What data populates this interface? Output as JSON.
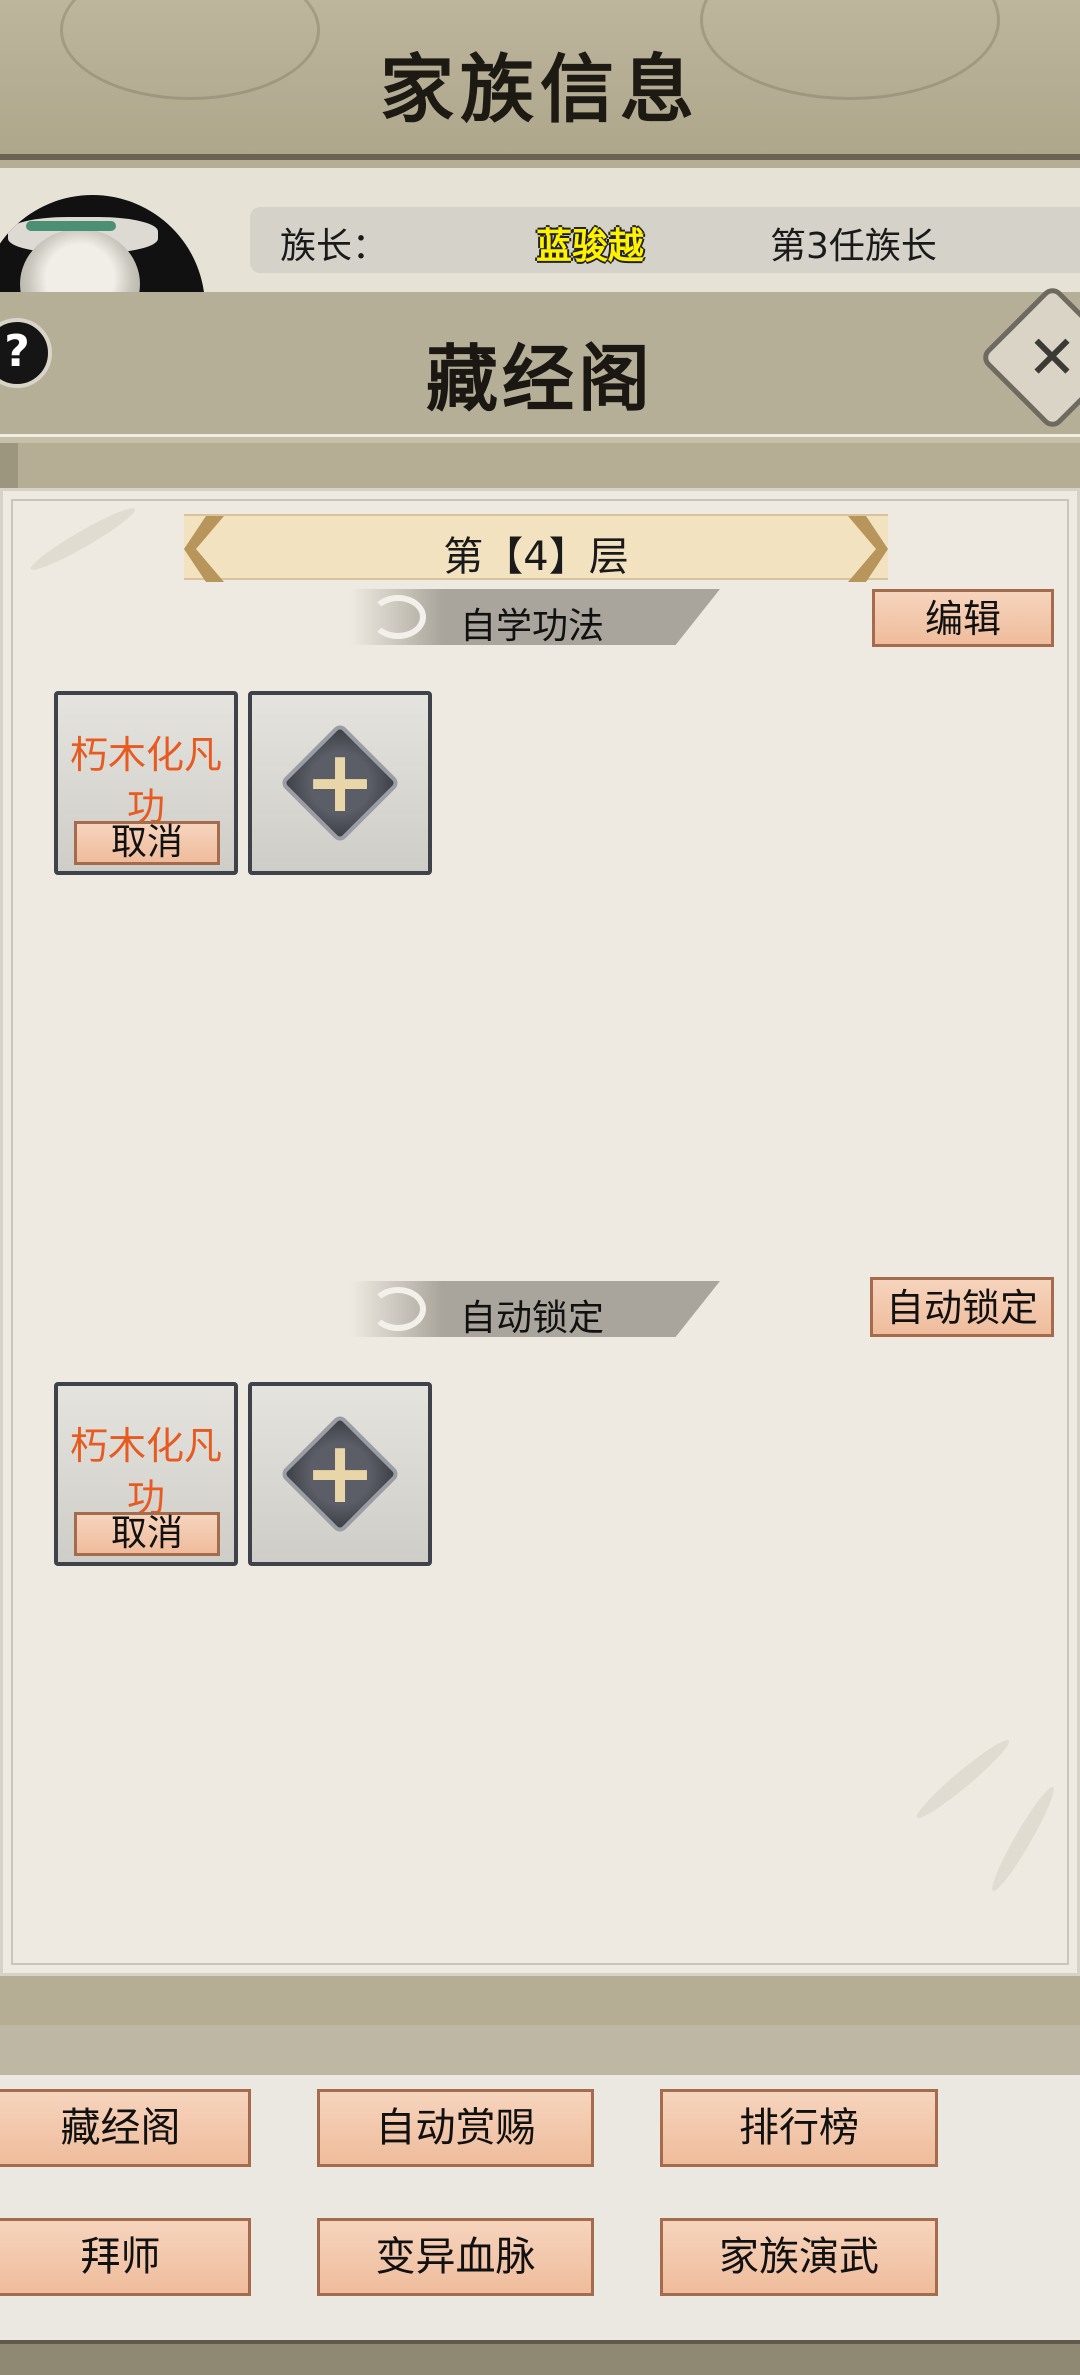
{
  "header": {
    "title": "家族信息"
  },
  "chief": {
    "label": "族长：",
    "name": "蓝骏越",
    "rank": "第3任族长"
  },
  "modal": {
    "title": "藏经阁",
    "help_label": "?",
    "close_label": "✕"
  },
  "floor": {
    "label": "第【4】层"
  },
  "sections": [
    {
      "title": "自学功法",
      "action_label": "编辑",
      "items": [
        {
          "name": "朽木化凡功",
          "cancel_label": "取消"
        }
      ],
      "add_label": "+"
    },
    {
      "title": "自动锁定",
      "action_label": "自动锁定",
      "items": [
        {
          "name": "朽木化凡功",
          "cancel_label": "取消"
        }
      ],
      "add_label": "+"
    }
  ],
  "nav": {
    "row1": [
      "藏经阁",
      "自动赏赐",
      "排行榜"
    ],
    "row2": [
      "拜师",
      "变异血脉",
      "家族演武"
    ]
  },
  "colors": {
    "item_name": "#e75a20",
    "chief_name": "#fff200",
    "button_fill": "#efbc9c",
    "panel_bg": "#efeae1"
  },
  "icons": [
    "question-icon",
    "close-icon",
    "cloud-icon",
    "plus-icon",
    "avatar"
  ]
}
